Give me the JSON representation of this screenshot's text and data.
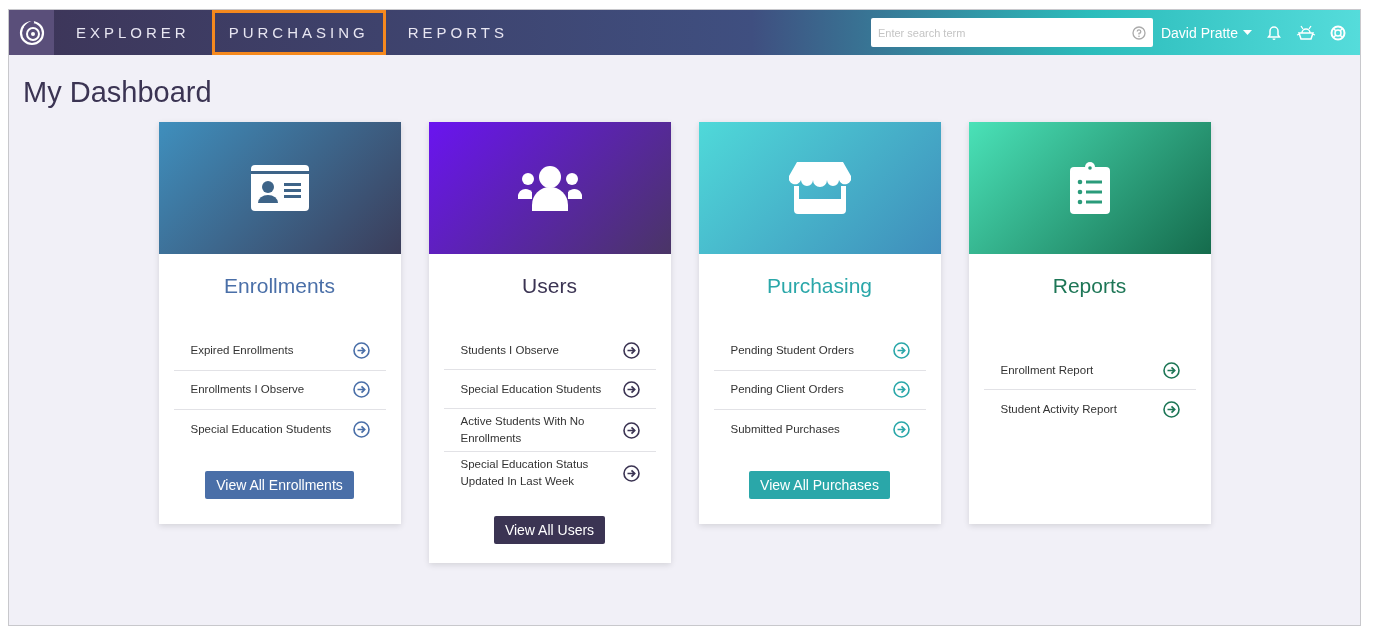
{
  "nav": {
    "items": [
      {
        "label": "EXPLORER",
        "highlighted": false
      },
      {
        "label": "PURCHASING",
        "highlighted": true
      },
      {
        "label": "REPORTS",
        "highlighted": false
      }
    ],
    "search": {
      "placeholder": "Enter search term"
    },
    "user": "David Pratte"
  },
  "page_title": "My Dashboard",
  "cards": [
    {
      "kind": "enrollments",
      "title": "Enrollments",
      "color": "#4a6fa8",
      "links": [
        "Expired Enrollments",
        "Enrollments I Observe",
        "Special Education Students"
      ],
      "button": "View All Enrollments"
    },
    {
      "kind": "users",
      "title": "Users",
      "color": "#3b3453",
      "links": [
        "Students I Observe",
        "Special Education Students",
        "Active Students With No Enrollments",
        "Special Education Status Updated In Last Week"
      ],
      "button": "View All Users"
    },
    {
      "kind": "purchasing",
      "title": "Purchasing",
      "color": "#2aa7a9",
      "links": [
        "Pending Student Orders",
        "Pending Client Orders",
        "Submitted Purchases"
      ],
      "button": "View All Purchases"
    },
    {
      "kind": "reports",
      "title": "Reports",
      "color": "#1d7656",
      "links": [
        "Enrollment Report",
        "Student Activity Report"
      ]
    }
  ]
}
